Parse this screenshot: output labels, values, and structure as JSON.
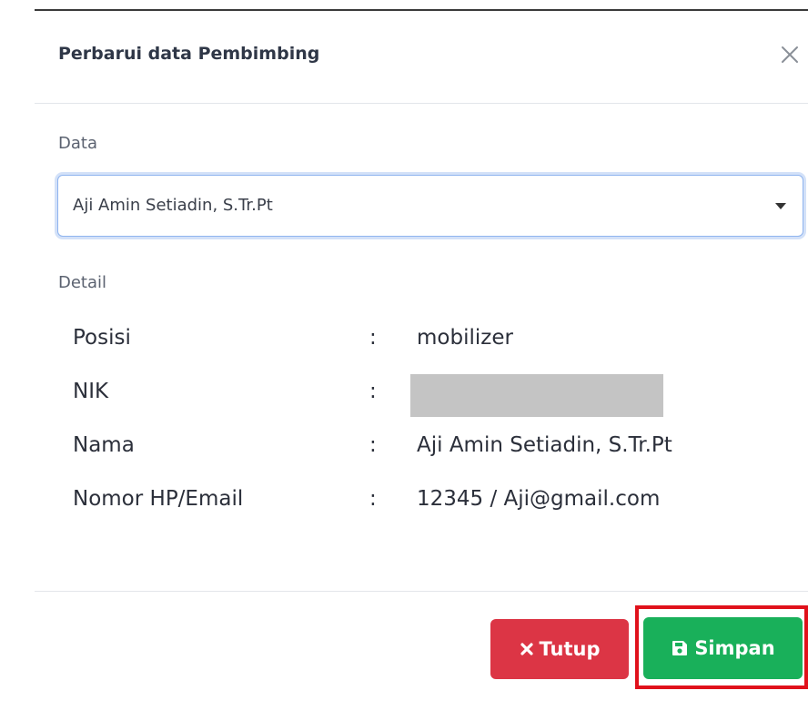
{
  "modal": {
    "title": "Perbarui data Pembimbing",
    "close_icon": "close-icon"
  },
  "data_section": {
    "label": "Data",
    "selected_value": "Aji Amin Setiadin, S.Tr.Pt"
  },
  "detail_section": {
    "label": "Detail",
    "rows": [
      {
        "key": "Posisi",
        "separator": ":",
        "value": "mobilizer"
      },
      {
        "key": "NIK",
        "separator": ":",
        "value": ""
      },
      {
        "key": "Nama",
        "separator": ":",
        "value": "Aji Amin Setiadin, S.Tr.Pt"
      },
      {
        "key": "Nomor HP/Email",
        "separator": ":",
        "value": "12345 / Aji@gmail.com"
      }
    ]
  },
  "footer": {
    "close_label": "Tutup",
    "save_label": "Simpan",
    "close_icon": "times-icon",
    "save_icon": "floppy-disk-icon"
  },
  "colors": {
    "danger": "#dc3545",
    "success": "#19b05a",
    "highlight": "#e0111b",
    "focus_border": "#8fb4ef"
  }
}
